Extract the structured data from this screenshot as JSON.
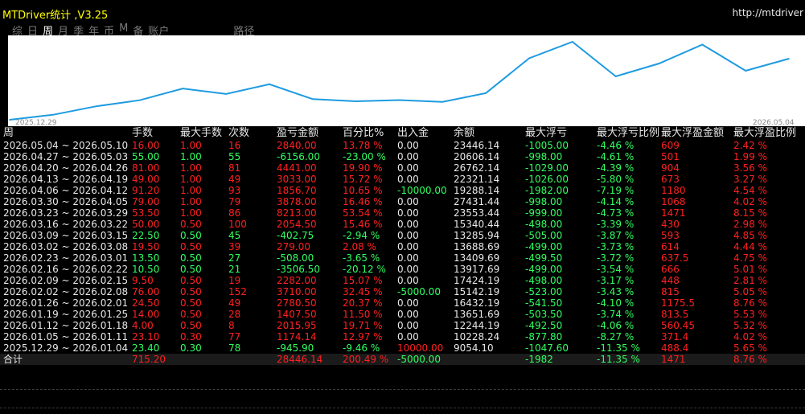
{
  "app": {
    "title": "MTDriver统计 ,V3.25",
    "url": "http://mtdriver"
  },
  "tabs": [
    {
      "label": "综",
      "active": false
    },
    {
      "label": "日",
      "active": false
    },
    {
      "label": "周",
      "active": true
    },
    {
      "label": "月",
      "active": false
    },
    {
      "label": "季",
      "active": false
    },
    {
      "label": "年",
      "active": false
    },
    {
      "label": "币",
      "active": false
    },
    {
      "label": "M",
      "active": false
    },
    {
      "label": "备",
      "active": false
    },
    {
      "label": "账户",
      "active": false
    },
    {
      "label": "路径",
      "active": false
    }
  ],
  "chart_data": {
    "type": "line",
    "x_start": "2025.12.29",
    "x_end": "2026.05.04",
    "x": [
      "2025.12.29",
      "2026.01.05",
      "2026.01.12",
      "2026.01.19",
      "2026.01.26",
      "2026.02.02",
      "2026.02.09",
      "2026.02.16",
      "2026.02.23",
      "2026.03.02",
      "2026.03.09",
      "2026.03.16",
      "2026.03.23",
      "2026.03.30",
      "2026.04.06",
      "2026.04.13",
      "2026.04.20",
      "2026.04.27",
      "2026.05.04"
    ],
    "values": [
      9054.1,
      10228.24,
      12244.19,
      13651.69,
      16432.19,
      15142.19,
      17424.19,
      13917.69,
      13409.69,
      13688.69,
      13285.94,
      15340.44,
      23553.44,
      27431.44,
      19288.14,
      22321.14,
      26762.14,
      20606.14,
      23446.14
    ],
    "line_color": "#1e9be0",
    "grid": false
  },
  "table": {
    "headers": [
      "周",
      "手数",
      "最大手数",
      "次数",
      "盈亏金额",
      "百分比%",
      "出入金",
      "余额",
      "最大浮亏",
      "最大浮亏比例",
      "最大浮盈金额",
      "最大浮盈比例"
    ],
    "rows": [
      {
        "week": "2026.05.04 ~ 2026.05.10",
        "lots": "16.00",
        "maxlots": "1.00",
        "count": "16",
        "pl": "2840.00",
        "pct": "13.78 %",
        "io": "0.00",
        "bal": "23446.14",
        "maxdd": "-1005.00",
        "ddpct": "-4.46 %",
        "maxfp": "609",
        "fppct": "2.42 %",
        "pos": true,
        "io_c": "neutral"
      },
      {
        "week": "2026.04.27 ~ 2026.05.03",
        "lots": "55.00",
        "maxlots": "1.00",
        "count": "55",
        "pl": "-6156.00",
        "pct": "-23.00 %",
        "io": "0.00",
        "bal": "20606.14",
        "maxdd": "-998.00",
        "ddpct": "-4.61 %",
        "maxfp": "501",
        "fppct": "1.99 %",
        "pos": false,
        "io_c": "neutral"
      },
      {
        "week": "2026.04.20 ~ 2026.04.26",
        "lots": "81.00",
        "maxlots": "1.00",
        "count": "81",
        "pl": "4441.00",
        "pct": "19.90 %",
        "io": "0.00",
        "bal": "26762.14",
        "maxdd": "-1029.00",
        "ddpct": "-4.39 %",
        "maxfp": "904",
        "fppct": "3.56 %",
        "pos": true,
        "io_c": "neutral"
      },
      {
        "week": "2026.04.13 ~ 2026.04.19",
        "lots": "49.00",
        "maxlots": "1.00",
        "count": "49",
        "pl": "3033.00",
        "pct": "15.72 %",
        "io": "0.00",
        "bal": "22321.14",
        "maxdd": "-1026.00",
        "ddpct": "-5.80 %",
        "maxfp": "673",
        "fppct": "3.27 %",
        "pos": true,
        "io_c": "neutral"
      },
      {
        "week": "2026.04.06 ~ 2026.04.12",
        "lots": "91.20",
        "maxlots": "1.00",
        "count": "93",
        "pl": "1856.70",
        "pct": "10.65 %",
        "io": "-10000.00",
        "bal": "19288.14",
        "maxdd": "-1982.00",
        "ddpct": "-7.19 %",
        "maxfp": "1180",
        "fppct": "4.54 %",
        "pos": true,
        "io_c": "green"
      },
      {
        "week": "2026.03.30 ~ 2026.04.05",
        "lots": "79.00",
        "maxlots": "1.00",
        "count": "79",
        "pl": "3878.00",
        "pct": "16.46 %",
        "io": "0.00",
        "bal": "27431.44",
        "maxdd": "-998.00",
        "ddpct": "-4.14 %",
        "maxfp": "1068",
        "fppct": "4.02 %",
        "pos": true,
        "io_c": "neutral"
      },
      {
        "week": "2026.03.23 ~ 2026.03.29",
        "lots": "53.50",
        "maxlots": "1.00",
        "count": "86",
        "pl": "8213.00",
        "pct": "53.54 %",
        "io": "0.00",
        "bal": "23553.44",
        "maxdd": "-999.00",
        "ddpct": "-4.73 %",
        "maxfp": "1471",
        "fppct": "8.15 %",
        "pos": true,
        "io_c": "neutral"
      },
      {
        "week": "2026.03.16 ~ 2026.03.22",
        "lots": "50.00",
        "maxlots": "0.50",
        "count": "100",
        "pl": "2054.50",
        "pct": "15.46 %",
        "io": "0.00",
        "bal": "15340.44",
        "maxdd": "-498.00",
        "ddpct": "-3.39 %",
        "maxfp": "430",
        "fppct": "2.98 %",
        "pos": true,
        "io_c": "neutral"
      },
      {
        "week": "2026.03.09 ~ 2026.03.15",
        "lots": "22.50",
        "maxlots": "0.50",
        "count": "45",
        "pl": "-402.75",
        "pct": "-2.94 %",
        "io": "0.00",
        "bal": "13285.94",
        "maxdd": "-505.00",
        "ddpct": "-3.87 %",
        "maxfp": "593",
        "fppct": "4.85 %",
        "pos": false,
        "io_c": "neutral"
      },
      {
        "week": "2026.03.02 ~ 2026.03.08",
        "lots": "19.50",
        "maxlots": "0.50",
        "count": "39",
        "pl": "279.00",
        "pct": "2.08 %",
        "io": "0.00",
        "bal": "13688.69",
        "maxdd": "-499.00",
        "ddpct": "-3.73 %",
        "maxfp": "614",
        "fppct": "4.44 %",
        "pos": true,
        "io_c": "neutral"
      },
      {
        "week": "2026.02.23 ~ 2026.03.01",
        "lots": "13.50",
        "maxlots": "0.50",
        "count": "27",
        "pl": "-508.00",
        "pct": "-3.65 %",
        "io": "0.00",
        "bal": "13409.69",
        "maxdd": "-499.50",
        "ddpct": "-3.72 %",
        "maxfp": "637.5",
        "fppct": "4.75 %",
        "pos": false,
        "io_c": "neutral"
      },
      {
        "week": "2026.02.16 ~ 2026.02.22",
        "lots": "10.50",
        "maxlots": "0.50",
        "count": "21",
        "pl": "-3506.50",
        "pct": "-20.12 %",
        "io": "0.00",
        "bal": "13917.69",
        "maxdd": "-499.00",
        "ddpct": "-3.54 %",
        "maxfp": "666",
        "fppct": "5.01 %",
        "pos": false,
        "io_c": "neutral"
      },
      {
        "week": "2026.02.09 ~ 2026.02.15",
        "lots": "9.50",
        "maxlots": "0.50",
        "count": "19",
        "pl": "2282.00",
        "pct": "15.07 %",
        "io": "0.00",
        "bal": "17424.19",
        "maxdd": "-498.00",
        "ddpct": "-3.17 %",
        "maxfp": "448",
        "fppct": "2.81 %",
        "pos": true,
        "io_c": "neutral"
      },
      {
        "week": "2026.02.02 ~ 2026.02.08",
        "lots": "76.00",
        "maxlots": "0.50",
        "count": "152",
        "pl": "3710.00",
        "pct": "32.45 %",
        "io": "-5000.00",
        "bal": "15142.19",
        "maxdd": "-523.00",
        "ddpct": "-3.43 %",
        "maxfp": "815",
        "fppct": "5.05 %",
        "pos": true,
        "io_c": "green"
      },
      {
        "week": "2026.01.26 ~ 2026.02.01",
        "lots": "24.50",
        "maxlots": "0.50",
        "count": "49",
        "pl": "2780.50",
        "pct": "20.37 %",
        "io": "0.00",
        "bal": "16432.19",
        "maxdd": "-541.50",
        "ddpct": "-4.10 %",
        "maxfp": "1175.5",
        "fppct": "8.76 %",
        "pos": true,
        "io_c": "neutral"
      },
      {
        "week": "2026.01.19 ~ 2026.01.25",
        "lots": "14.00",
        "maxlots": "0.50",
        "count": "28",
        "pl": "1407.50",
        "pct": "11.50 %",
        "io": "0.00",
        "bal": "13651.69",
        "maxdd": "-503.50",
        "ddpct": "-3.74 %",
        "maxfp": "813.5",
        "fppct": "5.53 %",
        "pos": true,
        "io_c": "neutral"
      },
      {
        "week": "2026.01.12 ~ 2026.01.18",
        "lots": "4.00",
        "maxlots": "0.50",
        "count": "8",
        "pl": "2015.95",
        "pct": "19.71 %",
        "io": "0.00",
        "bal": "12244.19",
        "maxdd": "-492.50",
        "ddpct": "-4.06 %",
        "maxfp": "560.45",
        "fppct": "5.32 %",
        "pos": true,
        "io_c": "neutral"
      },
      {
        "week": "2026.01.05 ~ 2026.01.11",
        "lots": "23.10",
        "maxlots": "0.30",
        "count": "77",
        "pl": "1174.14",
        "pct": "12.97 %",
        "io": "0.00",
        "bal": "10228.24",
        "maxdd": "-877.80",
        "ddpct": "-8.27 %",
        "maxfp": "371.4",
        "fppct": "4.02 %",
        "pos": true,
        "io_c": "neutral"
      },
      {
        "week": "2025.12.29 ~ 2026.01.04",
        "lots": "23.40",
        "maxlots": "0.30",
        "count": "78",
        "pl": "-945.90",
        "pct": "-9.46 %",
        "io": "10000.00",
        "bal": "9054.10",
        "maxdd": "-1047.60",
        "ddpct": "-11.35 %",
        "maxfp": "488.4",
        "fppct": "5.65 %",
        "pos": false,
        "io_c": "red"
      }
    ],
    "total": {
      "week": "合计",
      "lots": "715.20",
      "maxlots": "",
      "count": "",
      "pl": "28446.14",
      "pct": "200.49 %",
      "io": "-5000.00",
      "bal": "",
      "maxdd": "-1982",
      "ddpct": "-11.35 %",
      "maxfp": "1471",
      "fppct": "8.76 %"
    }
  },
  "colors": {
    "positive": "#ff2020",
    "negative": "#30ff60",
    "title": "#ffff00"
  }
}
